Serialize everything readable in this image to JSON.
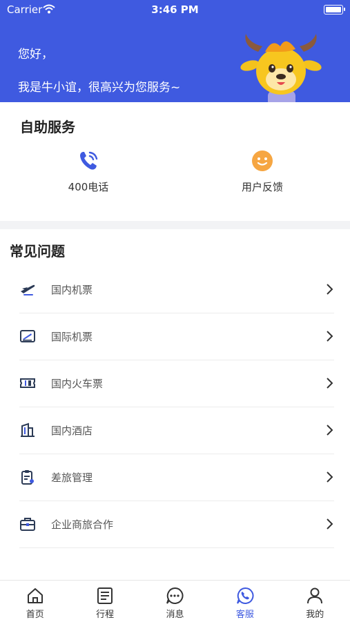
{
  "status_bar": {
    "carrier": "Carrier",
    "time": "3:46 PM"
  },
  "header": {
    "greeting_line1": "您好，",
    "greeting_line2": "我是牛小谊，很高兴为您服务~",
    "mascot": "yak-mascot-image",
    "background_color": "#3f5ae0"
  },
  "self_service": {
    "title": "自助服务",
    "items": [
      {
        "label": "400电话",
        "icon": "phone-icon"
      },
      {
        "label": "用户反馈",
        "icon": "feedback-smile-icon"
      }
    ]
  },
  "faq": {
    "title": "常见问题",
    "items": [
      {
        "label": "国内机票",
        "icon": "domestic-flight-icon"
      },
      {
        "label": "国际机票",
        "icon": "international-flight-icon"
      },
      {
        "label": "国内火车票",
        "icon": "train-ticket-icon"
      },
      {
        "label": "国内酒店",
        "icon": "hotel-icon"
      },
      {
        "label": "差旅管理",
        "icon": "travel-management-icon"
      },
      {
        "label": "企业商旅合作",
        "icon": "business-cooperation-icon"
      }
    ]
  },
  "tabbar": {
    "active": "客服",
    "accent_color": "#3f5ae0",
    "tabs": [
      {
        "label": "首页",
        "icon": "home-icon"
      },
      {
        "label": "行程",
        "icon": "itinerary-icon"
      },
      {
        "label": "消息",
        "icon": "message-icon"
      },
      {
        "label": "客服",
        "icon": "customer-service-icon"
      },
      {
        "label": "我的",
        "icon": "profile-icon"
      }
    ]
  }
}
